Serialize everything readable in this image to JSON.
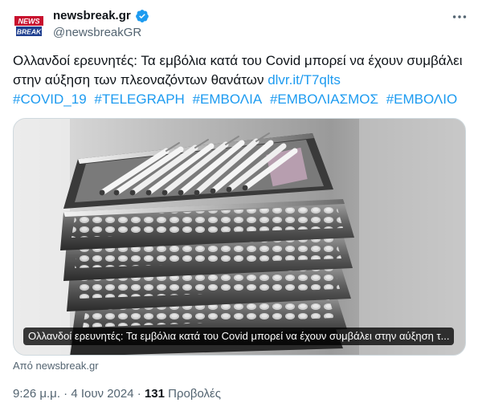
{
  "account": {
    "name": "newsbreak.gr",
    "handle": "@newsbreakGR",
    "avatar_text_top": "NEWS",
    "avatar_text_bottom": "BREAK"
  },
  "tweet": {
    "text": "Ολλανδοί ερευνητές: Τα εμβόλια κατά του Covid μπορεί να έχουν συμβάλει στην αύξηση των πλεοναζόντων θανάτων",
    "link": "dlvr.it/T7qlts",
    "hashtags": [
      "#COVID_19",
      "#TELEGRAPH",
      "#ΕΜΒΟΛΙΑ",
      "#ΕΜΒΟΛΙΑΣΜΟΣ",
      "#ΕΜΒΟΛΙΟ"
    ]
  },
  "media": {
    "caption": "Ολλανδοί ερευνητές: Τα εμβόλια κατά του Covid μπορεί να έχουν συμβάλει στην αύξηση τ..."
  },
  "source": "Από newsbreak.gr",
  "meta": {
    "time": "9:26 μ.μ.",
    "separator": " · ",
    "date": "4 Ιουν 2024",
    "views_count": "131",
    "views_label": "Προβολές"
  },
  "colors": {
    "accent": "#1d9bf0",
    "secondary_text": "#536471",
    "avatar_red": "#c8102e"
  },
  "icons": [
    "avatar-logo",
    "verified-badge-icon",
    "more-options-icon"
  ]
}
